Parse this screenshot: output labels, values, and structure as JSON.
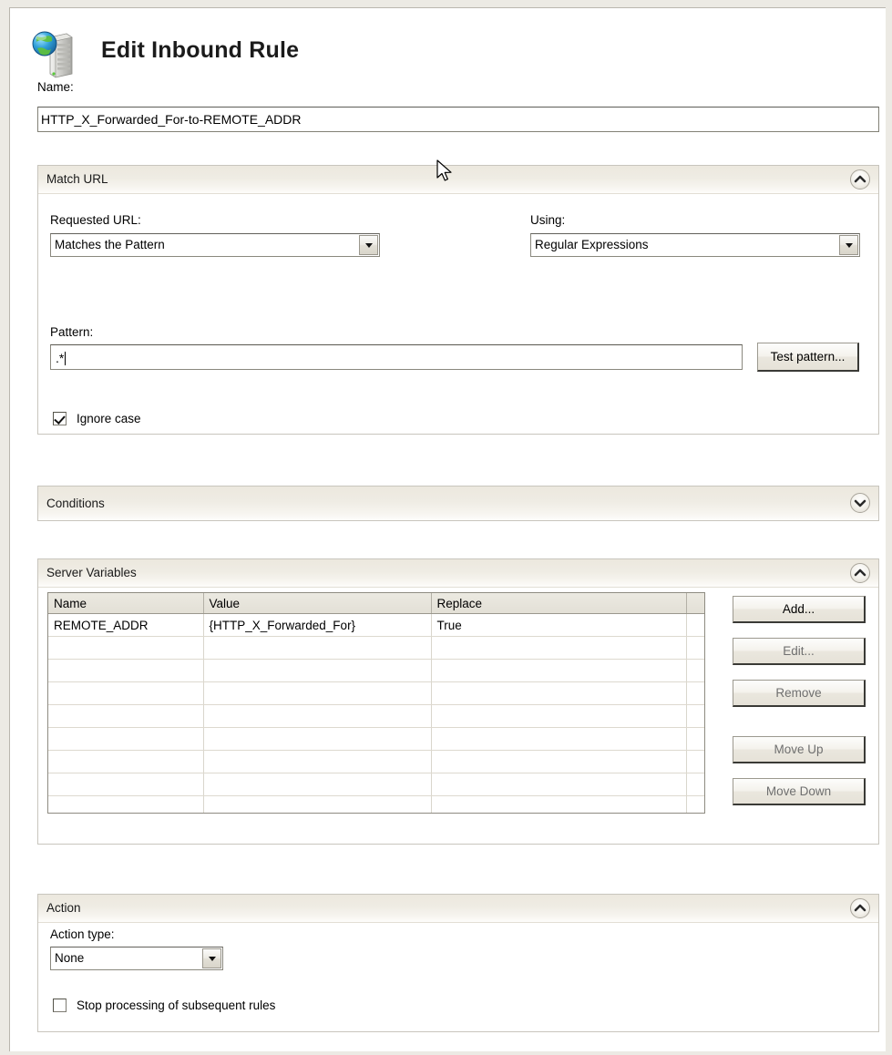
{
  "window": {
    "title": "Edit Inbound Rule",
    "icon": "globe-server-icon"
  },
  "name_field": {
    "label": "Name:",
    "value": "HTTP_X_Forwarded_For-to-REMOTE_ADDR"
  },
  "match_url": {
    "title": "Match URL",
    "collapse_state": "expanded",
    "requested_url": {
      "label": "Requested URL:",
      "value": "Matches the Pattern"
    },
    "using": {
      "label": "Using:",
      "value": "Regular Expressions"
    },
    "pattern": {
      "label": "Pattern:",
      "value": ".*"
    },
    "test_pattern_button": "Test pattern...",
    "ignore_case": {
      "label": "Ignore case",
      "checked": true
    }
  },
  "conditions": {
    "title": "Conditions",
    "collapse_state": "collapsed"
  },
  "server_variables": {
    "title": "Server Variables",
    "collapse_state": "expanded",
    "columns": [
      "Name",
      "Value",
      "Replace",
      ""
    ],
    "rows": [
      [
        "REMOTE_ADDR",
        "{HTTP_X_Forwarded_For}",
        "True",
        ""
      ],
      [
        "",
        "",
        "",
        ""
      ],
      [
        "",
        "",
        "",
        ""
      ],
      [
        "",
        "",
        "",
        ""
      ],
      [
        "",
        "",
        "",
        ""
      ],
      [
        "",
        "",
        "",
        ""
      ],
      [
        "",
        "",
        "",
        ""
      ],
      [
        "",
        "",
        "",
        ""
      ],
      [
        "",
        "",
        "",
        ""
      ]
    ],
    "buttons": [
      {
        "label": "Add...",
        "enabled": true
      },
      {
        "label": "Edit...",
        "enabled": false
      },
      {
        "label": "Remove",
        "enabled": false
      },
      {
        "label": "Move Up",
        "enabled": false
      },
      {
        "label": "Move Down",
        "enabled": false
      }
    ]
  },
  "action": {
    "title": "Action",
    "collapse_state": "expanded",
    "action_type": {
      "label": "Action type:",
      "value": "None"
    },
    "stop_processing": {
      "label": "Stop processing of subsequent rules",
      "checked": false
    }
  },
  "colors": {
    "window_bg": "#eceae4",
    "panel_bg": "#ffffff",
    "panel_border": "#c8c5bd",
    "header_gradient_top": "#ece8de",
    "header_gradient_bottom": "#fdfdfb",
    "grid_header_bg": "#e3e0d6",
    "text": "#000000",
    "disabled_text": "#6f6f6f"
  }
}
